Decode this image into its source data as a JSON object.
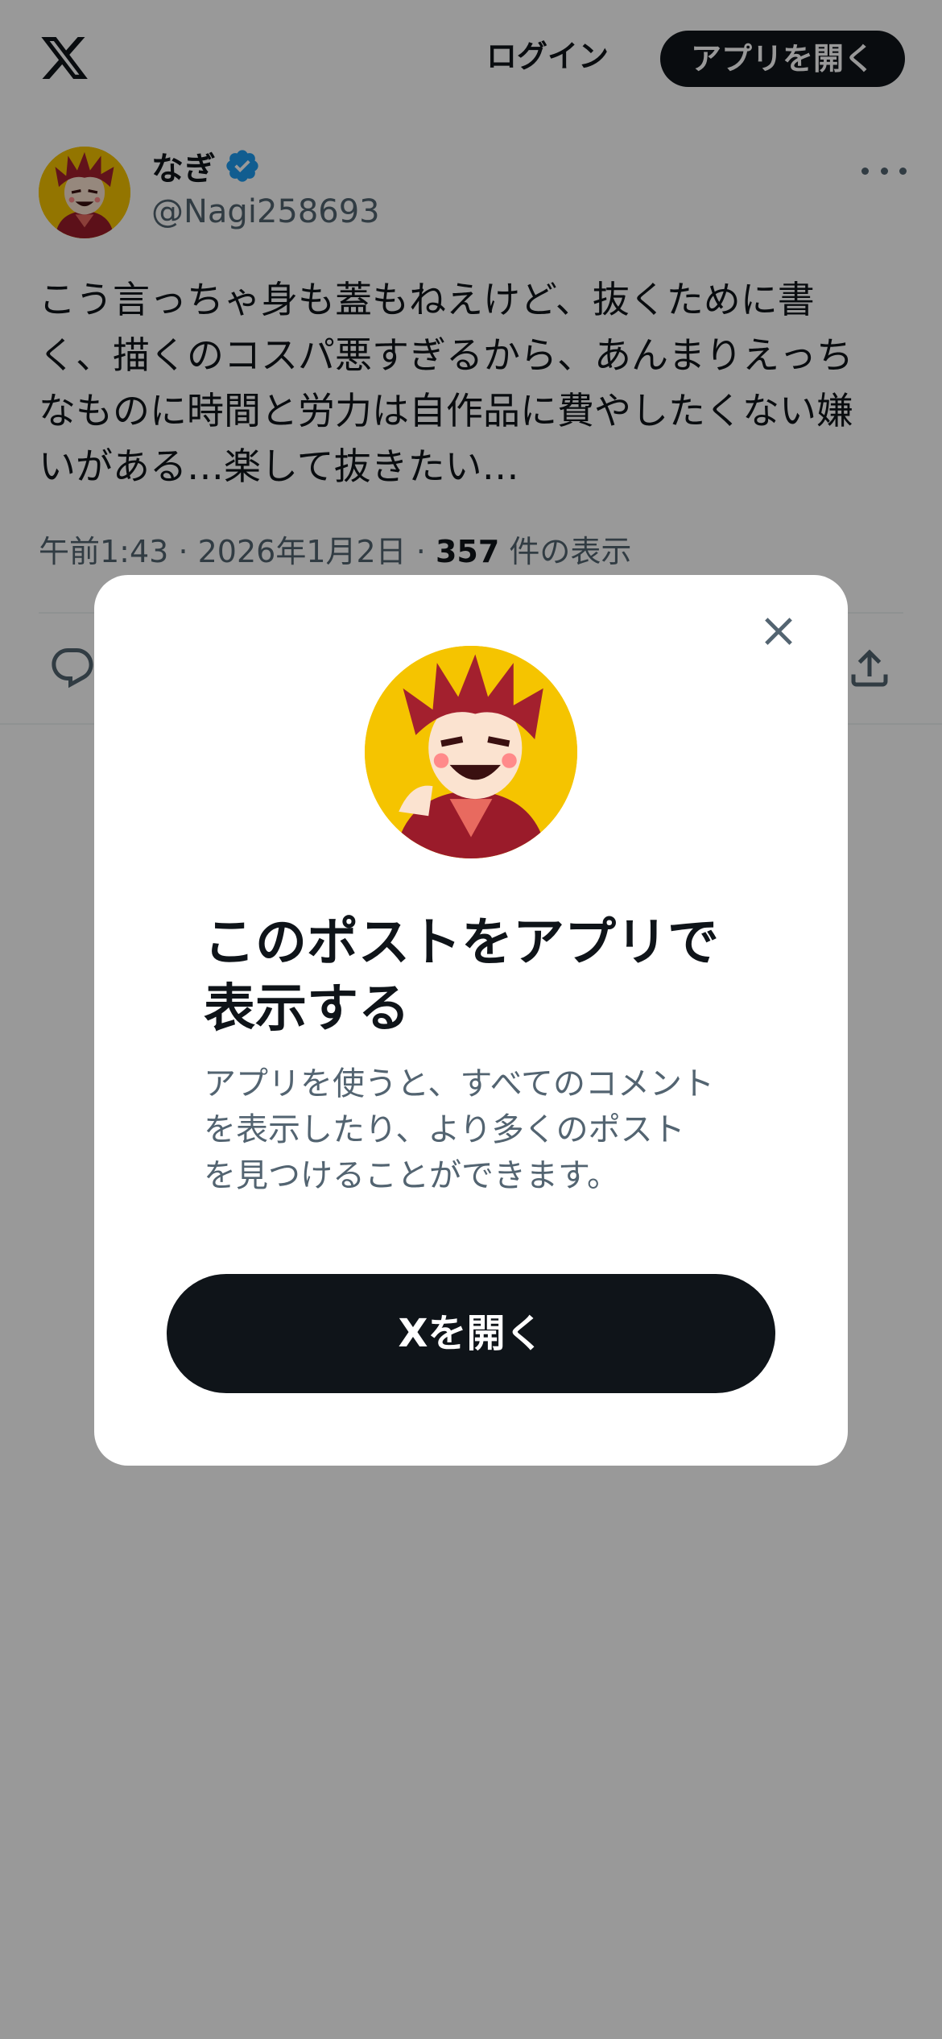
{
  "header": {
    "logo_icon": "x-logo-icon",
    "login_label": "ログイン",
    "open_app_label": "アプリを開く"
  },
  "post": {
    "author": {
      "display_name": "なぎ",
      "verified_icon": "verified-badge-icon",
      "handle": "@Nagi258693"
    },
    "text": "こう言っちゃ身も蓋もねえけど、抜くために書\nく、描くのコスパ悪すぎるから、あんまりえっち\nなものに時間と労力は自作品に費やしたくない嫌\nいがある…楽して抜きたい…",
    "time": "午前1:43",
    "separator": "·",
    "date": "2026年1月2日",
    "views_count": "357",
    "views_label": "件の表示",
    "actions": [
      "reply-icon",
      "share-icon"
    ]
  },
  "modal": {
    "title": "このポストをアプリで\n表示する",
    "description": "アプリを使うと、すべてのコメント\nを表示したり、より多くのポスト\nを見つけることができます。",
    "button_label": "Xを開く",
    "close_icon": "close-icon"
  },
  "colors": {
    "primary_text": "#0f1419",
    "secondary_text": "#536471",
    "verified_blue": "#1d9bf0",
    "avatar_bg": "#f5c400",
    "overlay": "rgba(0,0,0,0.4)"
  }
}
